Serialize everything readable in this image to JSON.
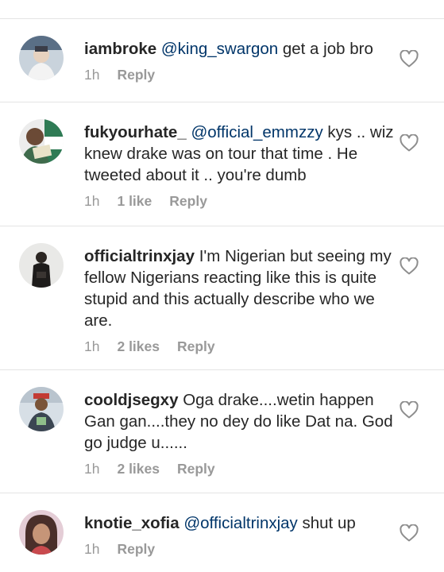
{
  "comments": [
    {
      "username": "iambroke",
      "mention": "@king_swargon",
      "text": " get a job bro",
      "time": "1h",
      "likes": "",
      "reply": "Reply"
    },
    {
      "username": "fukyourhate_",
      "mention": "@official_emmzzy",
      "text": " kys .. wiz knew drake was on tour that time . He tweeted about it .. you're dumb",
      "time": "1h",
      "likes": "1 like",
      "reply": "Reply"
    },
    {
      "username": "officialtrinxjay",
      "mention": "",
      "text": " I'm Nigerian but seeing my fellow Nigerians reacting like this is quite stupid and this actually describe who we are.",
      "time": "1h",
      "likes": "2 likes",
      "reply": "Reply"
    },
    {
      "username": "cooldjsegxy",
      "mention": "",
      "text": " Oga drake....wetin happen Gan gan....they no dey do like Dat na. God go judge u......",
      "time": "1h",
      "likes": "2 likes",
      "reply": "Reply"
    },
    {
      "username": "knotie_xofia",
      "mention": "@officialtrinxjay",
      "text": " shut up",
      "time": "1h",
      "likes": "",
      "reply": "Reply"
    }
  ],
  "icons": {
    "like": "heart-outline-icon"
  },
  "colors": {
    "username": "#262626",
    "mention": "#003569",
    "meta": "#999999",
    "divider": "#e4e4e4"
  }
}
